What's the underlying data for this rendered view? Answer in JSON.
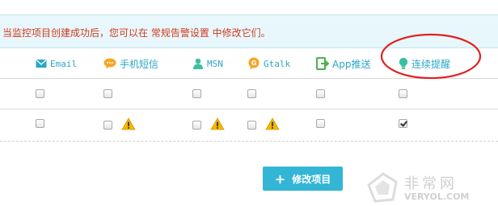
{
  "notice": {
    "text": "当监控项目创建成功后，您可以在 常规告警设置 中修改它们。"
  },
  "columns": [
    {
      "icon": "email-icon",
      "label": "Email",
      "color": "#2aa6c6"
    },
    {
      "icon": "sms-icon",
      "label": "手机短信",
      "color": "#f5a623"
    },
    {
      "icon": "msn-icon",
      "label": "MSN",
      "color": "#3cbfa0"
    },
    {
      "icon": "gtalk-icon",
      "label": "Gtalk",
      "color": "#f5a623"
    },
    {
      "icon": "app-push-icon",
      "label": "App推送",
      "color": "#4caf50"
    },
    {
      "icon": "lightbulb-icon",
      "label": "连续提醒",
      "color": "#3cbfa0"
    }
  ],
  "rows": [
    {
      "checks": [
        false,
        false,
        false,
        false,
        false,
        false
      ],
      "warnings": [
        false,
        false,
        false,
        false
      ]
    },
    {
      "checks": [
        false,
        false,
        false,
        false,
        false,
        true
      ],
      "warnings": [
        false,
        true,
        true,
        true
      ]
    }
  ],
  "submit_button": {
    "label": "修改项目",
    "icon": "plus-icon"
  },
  "watermark": {
    "cn": "非常网",
    "en": "VERYOL.COM"
  },
  "colors": {
    "accent": "#33b5d6",
    "notice_bg": "#e8f7fb",
    "notice_text": "#d03a1f",
    "annotation": "#e02020",
    "warning": "#f5b800"
  }
}
